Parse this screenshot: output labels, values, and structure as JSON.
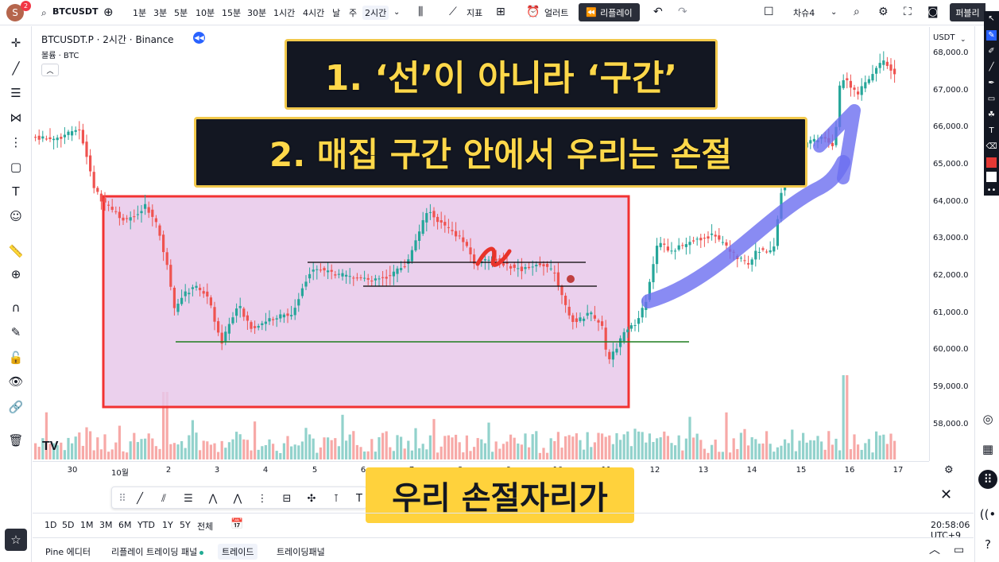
{
  "topbar": {
    "avatar_letter": "S",
    "notification_count": "2",
    "symbol": "BTCUSDT",
    "timeframes": [
      "1분",
      "3분",
      "5분",
      "10분",
      "15분",
      "30분",
      "1시간",
      "4시간",
      "날",
      "주",
      "2시간"
    ],
    "active_timeframe": "2시간",
    "indicators_label": "지표",
    "alert_label": "얼러트",
    "replay_label": "리플레이",
    "layout_label": "차슈4",
    "publish_label": "퍼블리"
  },
  "legend": {
    "title": "BTCUSDT.P · 2시간 · Binance",
    "volume_label": "볼륨 · BTC"
  },
  "captions": {
    "line1": "1. ‘선’이 아니라 ‘구간’",
    "line2": "2. 매집 구간 안에서 우리는 손절",
    "subtitle": "우리 손절자리가"
  },
  "price_axis": {
    "currency": "USDT",
    "labels": [
      "68,000.0",
      "67,000.0",
      "66,000.0",
      "65,000.0",
      "64,000.0",
      "63,000.0",
      "62,000.0",
      "61,000.0",
      "60,000.0",
      "59,000.0",
      "58,000.0"
    ]
  },
  "time_axis": {
    "labels": [
      "30",
      "10월",
      "2",
      "3",
      "4",
      "5",
      "6",
      "7",
      "8",
      "9",
      "10",
      "11",
      "12",
      "13",
      "14",
      "15",
      "16",
      "17"
    ]
  },
  "range_bar": {
    "ranges": [
      "1D",
      "5D",
      "1M",
      "3M",
      "6M",
      "YTD",
      "1Y",
      "5Y",
      "전체"
    ],
    "clock": "20:58:06 UTC+9"
  },
  "bottom_tabs": {
    "items": [
      "Pine 에디터",
      "리플레이 트레이딩 패널",
      "트레이드",
      "트레이딩패널"
    ]
  },
  "colors": {
    "up": "#26a69a",
    "down": "#ef5350",
    "zone_fill": "#e8c8ea",
    "zone_border": "#f23232",
    "support_line": "#1e7d1e",
    "arrow": "#6b6ef0"
  }
}
